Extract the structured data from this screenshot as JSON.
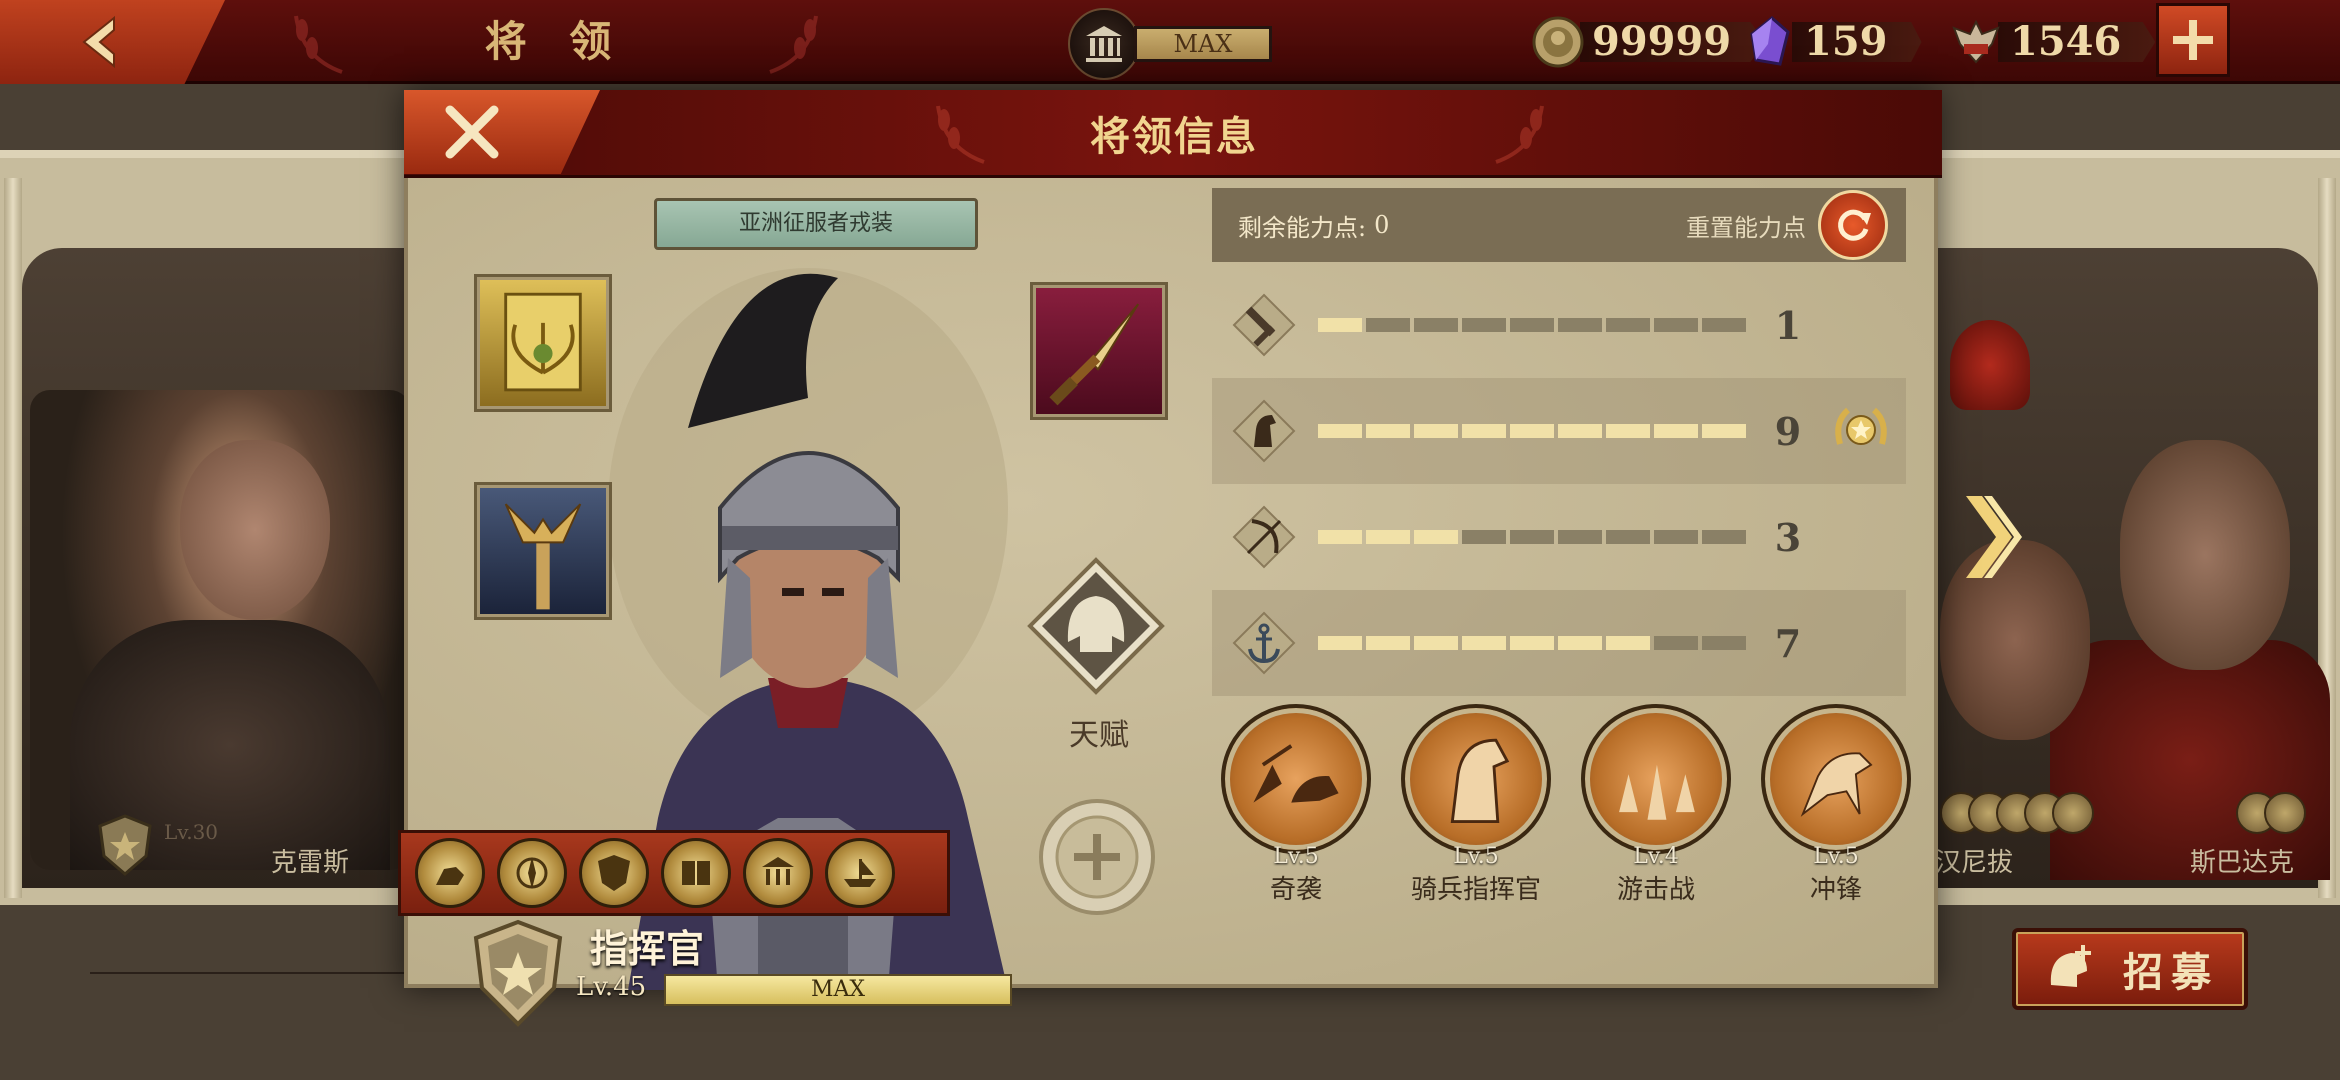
{
  "topbar": {
    "title": "将 领",
    "building_max": "MAX",
    "coins": "99999",
    "gems": "159",
    "tokens": "1546"
  },
  "background": {
    "left_general": {
      "level": "Lv.30",
      "name": "克雷斯"
    },
    "right_generals": [
      {
        "name": "汉尼拔"
      },
      {
        "name": "斯巴达克"
      }
    ],
    "recruit_label": "招募"
  },
  "dialog": {
    "title": "将领信息",
    "costume": "亚洲征服者戎装",
    "talent_label": "天赋",
    "rank": "指挥官",
    "level": "Lv.45",
    "level_bar": "MAX",
    "stats": {
      "points_label": "剩余能力点:",
      "points_value": "0",
      "reset_label": "重置能力点",
      "rows": [
        {
          "icon": "sword-icon",
          "value": "1"
        },
        {
          "icon": "horse-icon",
          "value": "9"
        },
        {
          "icon": "bow-icon",
          "value": "3"
        },
        {
          "icon": "anchor-icon",
          "value": "7"
        }
      ]
    },
    "skills": [
      {
        "level": "Lv.5",
        "name": "奇袭"
      },
      {
        "level": "Lv.5",
        "name": "骑兵指挥官"
      },
      {
        "level": "Lv.4",
        "name": "游击战"
      },
      {
        "level": "Lv.5",
        "name": "冲锋"
      }
    ]
  },
  "colors": {
    "accent_red": "#7a140e",
    "gold": "#f1d58f",
    "parchment": "#c8bc9a"
  }
}
